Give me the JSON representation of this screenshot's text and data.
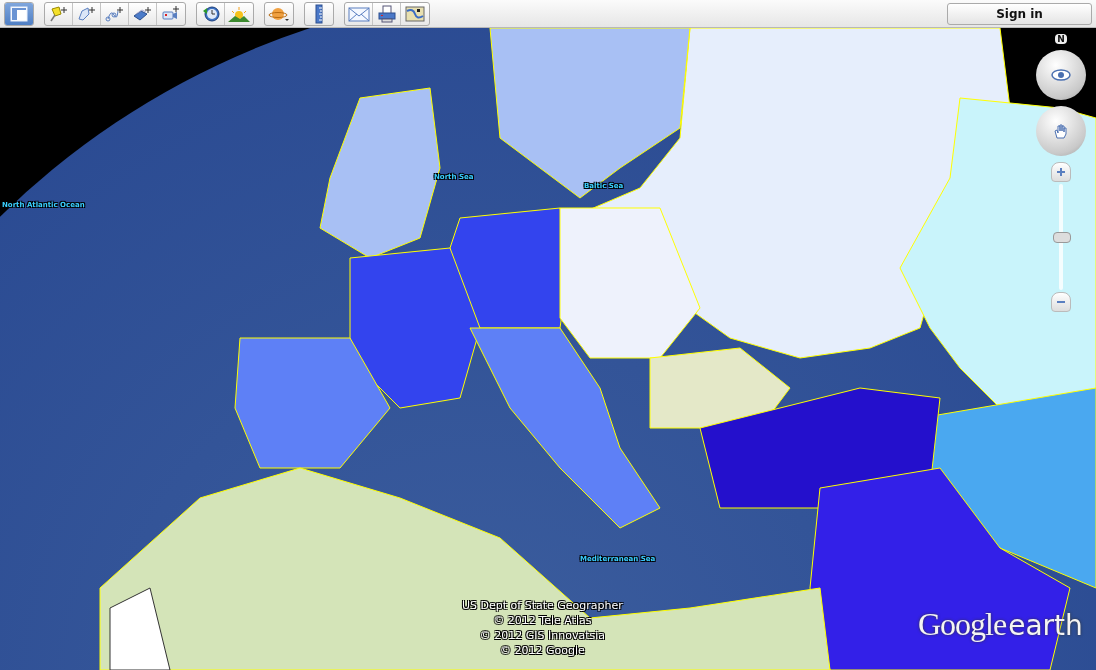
{
  "toolbar": {
    "sidebar_on": true
  },
  "sign_in": "Sign in",
  "map_labels": [
    "North Atlantic Ocean",
    "North Sea",
    "Baltic Sea",
    "Mediterranean Sea"
  ],
  "navigation": {
    "north": "N"
  },
  "attribution": [
    "US Dept of State Geographer",
    "© 2012 Tele Atlas",
    "© 2012 GIS Innovatsia",
    "© 2012 Google"
  ],
  "logo": {
    "brand": "Google",
    "product": "earth"
  }
}
